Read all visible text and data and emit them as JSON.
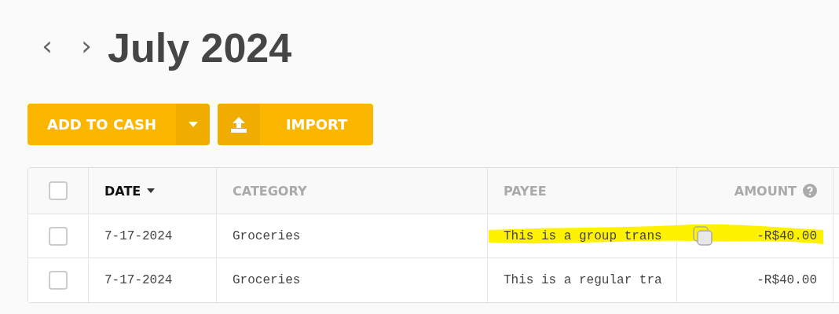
{
  "header": {
    "prev": "‹",
    "next": "›",
    "title": "July 2024"
  },
  "actions": {
    "add_button": "ADD TO CASH",
    "import_button": "IMPORT"
  },
  "table": {
    "select_all": {
      "checked": false
    },
    "columns": [
      {
        "label": "DATE",
        "sorted": true
      },
      {
        "label": "CATEGORY",
        "sorted": false
      },
      {
        "label": "PAYEE",
        "sorted": false
      },
      {
        "label": "AMOUNT",
        "sorted": false,
        "help": true
      }
    ],
    "rows": [
      {
        "checked": false,
        "date": "7-17-2024",
        "category": "Groceries",
        "payee": "This is a group trans",
        "amount": "-R$40.00",
        "kind": "group",
        "highlighted": true
      },
      {
        "checked": false,
        "date": "7-17-2024",
        "category": "Groceries",
        "payee": "This is a regular tra",
        "amount": "-R$40.00",
        "kind": "regular",
        "highlighted": false
      }
    ]
  }
}
